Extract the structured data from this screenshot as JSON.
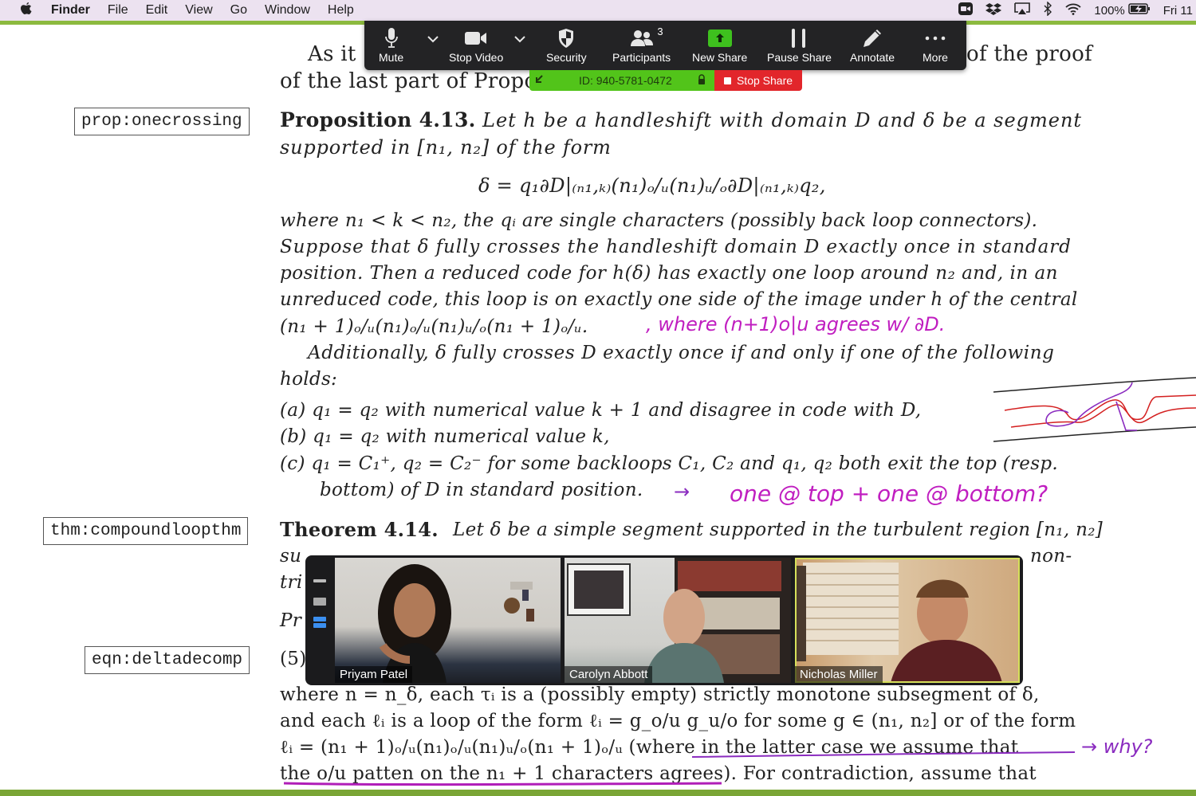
{
  "menubar": {
    "apple_icon": "apple-icon",
    "app_name": "Finder",
    "items": [
      "File",
      "Edit",
      "View",
      "Go",
      "Window",
      "Help"
    ],
    "status": {
      "icons": [
        "zoom-icon",
        "dropbox-icon",
        "airplay-icon",
        "bluetooth-icon",
        "wifi-icon"
      ],
      "battery_percent": "100%",
      "battery_icon": "battery-charging-icon",
      "clock": "Fri 11"
    }
  },
  "zoom_toolbar": {
    "items": [
      {
        "label": "Mute",
        "icon": "microphone-icon"
      },
      {
        "label": "Stop Video",
        "icon": "video-camera-icon"
      },
      {
        "label": "Security",
        "icon": "shield-icon"
      },
      {
        "label": "Participants",
        "icon": "participants-icon",
        "count": "3"
      },
      {
        "label": "New Share",
        "icon": "share-arrow-icon"
      },
      {
        "label": "Pause Share",
        "icon": "pause-icon"
      },
      {
        "label": "Annotate",
        "icon": "pencil-icon"
      },
      {
        "label": "More",
        "icon": "ellipsis-icon"
      }
    ],
    "meeting_id": "ID: 940-5781-0472",
    "stop_share_label": "Stop Share",
    "accent_green": "#52c41a",
    "accent_red": "#e2262b"
  },
  "document": {
    "intro_line1_left": "As it",
    "intro_line1_right": "of the proof",
    "intro_line2": "of the last part of Proposi",
    "labels": [
      "prop:onecrossing",
      "thm:compoundloopthm",
      "eqn:deltadecomp"
    ],
    "proposition": {
      "heading": "Proposition 4.13.",
      "line1": "Let h be a handleshift with domain D and δ be a segment",
      "line2": "supported in [n₁, n₂] of the form",
      "equation": "δ = q₁∂D|₍ₙ₁,ₖ₎(n₁)ₒ/ᵤ(n₁)ᵤ/ₒ∂D|₍ₙ₁,ₖ₎q₂,",
      "body": [
        "where n₁ < k < n₂, the qᵢ are single characters (possibly back loop connectors).",
        "Suppose that δ fully crosses the handleshift domain D exactly once in standard",
        "position. Then a reduced code for h(δ) has exactly one loop around n₂ and, in an",
        "unreduced code, this loop is on exactly one side of the image under h of the central",
        "(n₁ + 1)ₒ/ᵤ(n₁)ₒ/ᵤ(n₁)ᵤ/ₒ(n₁ + 1)ₒ/ᵤ.",
        "Additionally, δ fully crosses D exactly once if and only if one of the following",
        "holds:"
      ],
      "cases": [
        "(a) q₁ = q₂ with numerical value k + 1 and disagree in code with D,",
        "(b) q₁ = q₂ with numerical value k,",
        "(c) q₁ = C₁⁺, q₂ = C₂⁻ for some backloops C₁, C₂ and q₁, q₂ both exit the top (resp.",
        "bottom) of D in standard position."
      ]
    },
    "theorem": {
      "heading": "Theorem 4.14.",
      "line1": "Let δ be a simple segment supported in the turbulent region [n₁, n₂]",
      "line2_start": "su",
      "line2_end": "non-",
      "line3_start": "tri",
      "proof_start": "Pr",
      "eqn_number": "(5)"
    },
    "bottom_lines": [
      "where n = n_δ, each τᵢ is a (possibly empty) strictly monotone subsegment of δ,",
      "and each ℓᵢ is a loop of the form ℓᵢ = g_o/u g_u/o for some g ∈ (n₁, n₂] or of the form",
      "ℓᵢ = (n₁ + 1)ₒ/ᵤ(n₁)ₒ/ᵤ(n₁)ᵤ/ₒ(n₁ + 1)ₒ/ᵤ (where in the latter case we assume that",
      "the o/u patten on the n₁ + 1 characters agrees). For contradiction, assume that"
    ]
  },
  "annotations": {
    "note1": ", where (n+1)o|u agrees w/ ∂D.",
    "note2_arrow": "→",
    "note2": "one @ top + one @ bottom?",
    "note3": "→ why?",
    "ink_magenta": "#c01ec0",
    "ink_purple": "#8a2bbf",
    "ink_red": "#d42020"
  },
  "video_panel": {
    "participants": [
      {
        "name": "Priyam Patel",
        "active_speaker": false
      },
      {
        "name": "Carolyn Abbott",
        "active_speaker": false
      },
      {
        "name": "Nicholas Miller",
        "active_speaker": true
      }
    ],
    "view_controls": [
      "minimize-icon",
      "thumbnail-view-icon",
      "gallery-strip-icon"
    ]
  }
}
